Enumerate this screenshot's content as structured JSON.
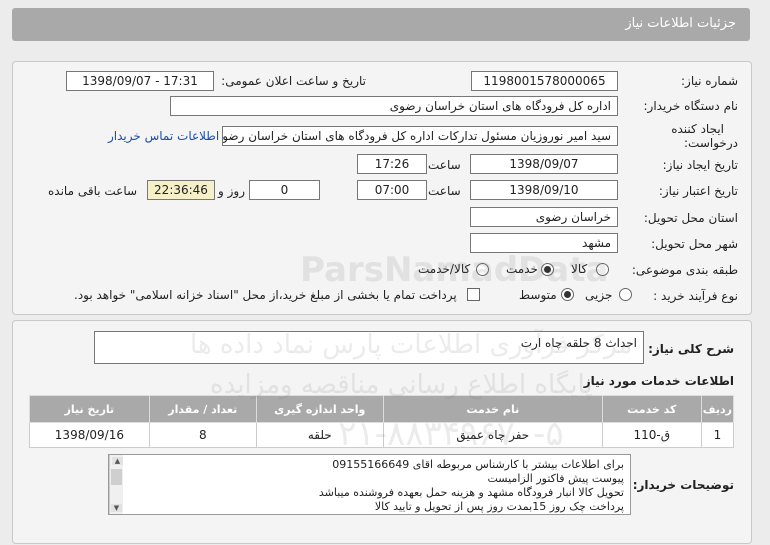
{
  "header": {
    "title": "جزئیات اطلاعات نیاز"
  },
  "form": {
    "need_number_label": "شماره نیاز:",
    "need_number": "1198001578000065",
    "announce_label": "تاریخ و ساعت اعلان عمومی:",
    "announce_value": "1398/09/07 - 17:31",
    "buyer_label": "نام دستگاه خریدار:",
    "buyer_value": "اداره کل فرودگاه های استان خراسان رضوی",
    "creator_label": "ایجاد کننده درخواست:",
    "creator_value": "سید امیر نوروزیان مسئول تدارکات اداره کل فرودگاه های استان خراسان رضوی",
    "contact_link": "اطلاعات تماس خریدار",
    "create_date_label": "تاریخ ایجاد نیاز:",
    "create_date": "1398/09/07",
    "time_label": "ساعت",
    "create_time": "17:26",
    "validity_label": "تاریخ اعتبار نیاز:",
    "validity_date": "1398/09/10",
    "validity_time": "07:00",
    "days_value": "0",
    "days_label": "روز و",
    "remaining_value": "22:36:46",
    "remaining_label": "ساعت باقی مانده",
    "province_label": "استان محل تحویل:",
    "province_value": "خراسان رضوی",
    "city_label": "شهر محل تحویل:",
    "city_value": "مشهد",
    "category_label": "طبقه بندی موضوعی:",
    "category_options": [
      "کالا",
      "خدمت",
      "کالا/خدمت"
    ],
    "category_selected": "خدمت",
    "process_label": "نوع فرآیند خرید :",
    "process_options": [
      "جزیی",
      "متوسط"
    ],
    "process_selected": "متوسط",
    "payment_note": "پرداخت تمام یا بخشی از مبلغ خرید،از محل \"اسناد خزانه اسلامی\" خواهد بود."
  },
  "summary": {
    "label": "شرح کلی نیاز:",
    "value": "احداث 8 حلقه چاه ارت"
  },
  "services": {
    "title": "اطلاعات خدمات مورد نیاز",
    "columns": [
      "ردیف",
      "کد خدمت",
      "نام خدمت",
      "واحد اندازه گیری",
      "تعداد / مقدار",
      "تاریخ نیاز"
    ],
    "rows": [
      [
        "1",
        "ق-110",
        "حفر چاه عمیق",
        "حلقه",
        "8",
        "1398/09/16"
      ]
    ]
  },
  "buyer_notes": {
    "label": "توضیحات خریدار:",
    "lines": [
      "برای اطلاعات بیشتر با کارشناس مربوطه اقای 09155166649",
      "پیوست پیش فاکتور الزامیست",
      "تحویل کالا انبار فرودگاه مشهد و هزینه حمل بعهده فروشنده میباشد",
      "پرداخت چک روز 15بمدت  روز پس از تحویل و تایید کالا"
    ]
  },
  "watermark": {
    "line1": "ParsNamadData",
    "line2": "مرکز فرآوری اطلاعات پارس نماد داده ها",
    "line3": "پایگاه اطلاع رسانی مناقصه ومزایده",
    "line4": "۰۲۱-۸۸۳۴۹۶۷۰-۵"
  }
}
